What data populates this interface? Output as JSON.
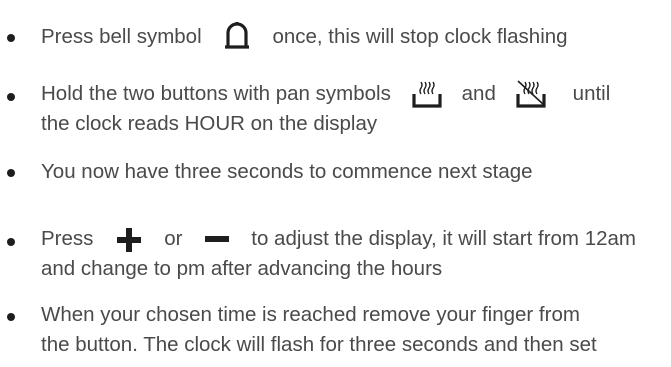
{
  "instructions": {
    "step_1": {
      "before_icon": "Press bell symbol",
      "after_icon": "once, this will stop clock flashing",
      "icon": "bell-icon"
    },
    "step_2": {
      "before_icon": "Hold the two buttons with pan symbols",
      "between_icons": "and",
      "after_icons": "until",
      "line_2": "the clock reads HOUR on the display",
      "icon_1": "pan-heat-icon",
      "icon_2": "pan-heat-off-icon"
    },
    "step_3": {
      "text": "You now have three seconds to commence next stage"
    },
    "step_4": {
      "before_icons": "Press",
      "between_icons": "or",
      "after_icons": "to adjust the display, it will start from 12am",
      "line_2": "and change to pm after advancing the hours",
      "icon_1": "plus-icon",
      "icon_2": "minus-icon"
    },
    "step_5": {
      "line_1": "When your chosen time is reached remove your finger from",
      "line_2": "the button. The clock will flash for three seconds and then set"
    }
  },
  "colors": {
    "text": "#4a4a4a",
    "bullet": "#1e1e1e",
    "icon": "#1e1e1e"
  }
}
